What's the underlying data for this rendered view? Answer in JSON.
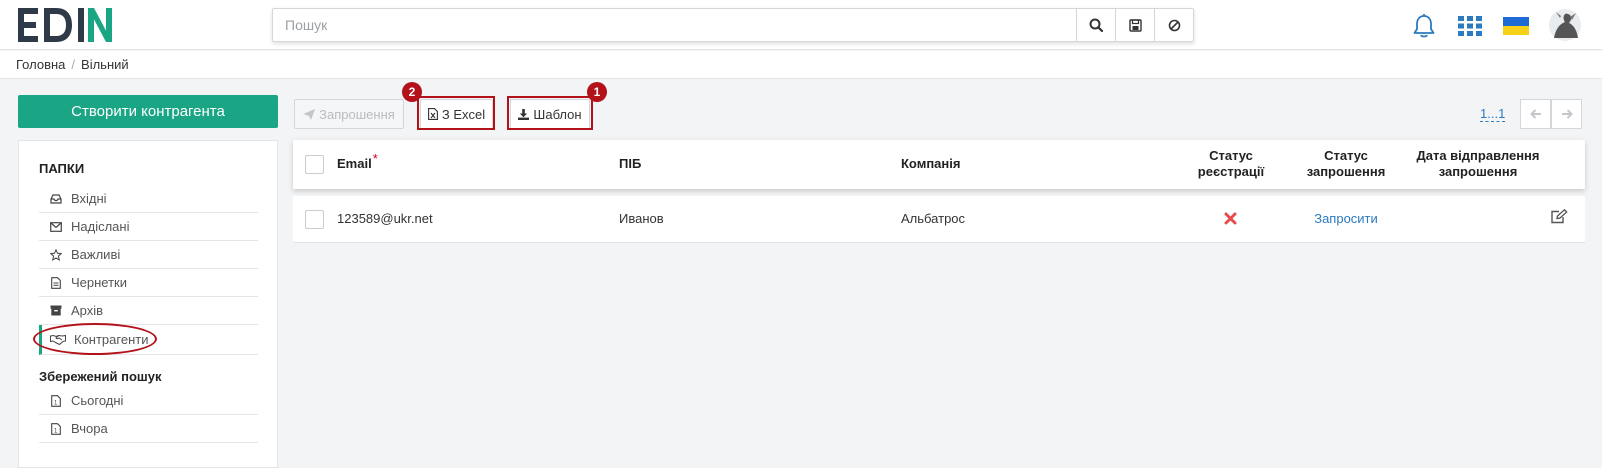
{
  "header": {
    "logo_text": "EDIN",
    "search_placeholder": "Пошук",
    "icons": [
      "search-icon",
      "save-icon",
      "clear-icon",
      "bell-icon",
      "apps-grid-icon",
      "ukraine-flag-icon",
      "avatar"
    ],
    "colors": {
      "logo_dark": "#2e3a47",
      "logo_accent": "#1aa585"
    }
  },
  "breadcrumb": {
    "items": [
      "Головна",
      "Вільний"
    ]
  },
  "sidebar": {
    "create_button": "Створити контрагента",
    "folders_heading": "ПАПКИ",
    "folders": [
      {
        "label": "Вхідні",
        "icon": "inbox-icon"
      },
      {
        "label": "Надіслані",
        "icon": "envelope-icon"
      },
      {
        "label": "Важливі",
        "icon": "star-icon"
      },
      {
        "label": "Чернетки",
        "icon": "draft-icon"
      },
      {
        "label": "Архів",
        "icon": "archive-icon"
      },
      {
        "label": "Контрагенти",
        "icon": "handshake-icon",
        "active": true
      }
    ],
    "saved_heading": "Збережений пошук",
    "saved": [
      {
        "label": "Сьогодні",
        "icon": "calendar-icon"
      },
      {
        "label": "Вчора",
        "icon": "calendar-icon"
      }
    ]
  },
  "toolbar": {
    "invite_label": "Запрошення",
    "excel_label": "З Excel",
    "template_label": "Шаблон",
    "badge_excel": "2",
    "badge_template": "1",
    "pager": "1...1"
  },
  "table": {
    "columns": {
      "email": "Email",
      "name": "ПІБ",
      "company": "Компанія",
      "reg_status_1": "Статус",
      "reg_status_2": "реєстрації",
      "inv_status_1": "Статус",
      "inv_status_2": "запрошення",
      "sent_date_1": "Дата відправлення",
      "sent_date_2": "запрошення"
    },
    "rows": [
      {
        "email": "123589@ukr.net",
        "name": "Иванов",
        "company": "Альбатрос",
        "reg_status": "not-registered",
        "invite": "Запросити",
        "sent_date": ""
      }
    ]
  },
  "colors": {
    "accent": "#1aa585",
    "annotation": "#b3121b",
    "link": "#2a7bc0",
    "error": "#e74c4c"
  }
}
